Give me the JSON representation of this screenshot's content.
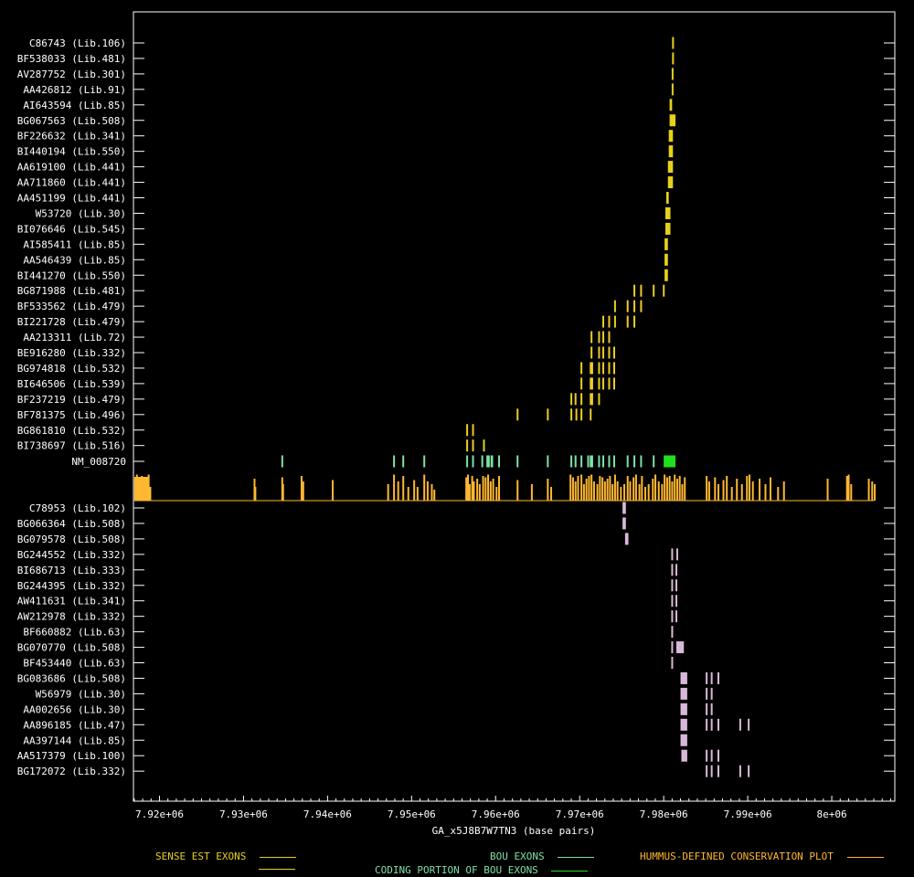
{
  "chart_data": {
    "type": "gene-track",
    "xlabel": "GA_x5J8B7W7TN3 (base pairs)",
    "x_ticks": [
      "7.92e+06",
      "7.93e+06",
      "7.94e+06",
      "7.95e+06",
      "7.96e+06",
      "7.97e+06",
      "7.98e+06",
      "7.99e+06",
      "8e+06"
    ],
    "x_tick_values": [
      7920000,
      7930000,
      7940000,
      7950000,
      7960000,
      7970000,
      7980000,
      7990000,
      8000000
    ],
    "xlim": [
      7916900,
      8007500
    ],
    "colors": {
      "sense": "#e6d01e",
      "sense_light": "#f0c830",
      "bou": "#7fe0a8",
      "bou_coding": "#20e020",
      "conservation": "#ffb830",
      "antisense": "#d8b8d8",
      "axis": "#ffffff"
    },
    "sense_ests": [
      {
        "label": "C86743 (Lib.106)",
        "exons": [
          [
            7981000,
            7981200
          ]
        ]
      },
      {
        "label": "BF538033 (Lib.481)",
        "exons": [
          [
            7981000,
            7981200
          ]
        ]
      },
      {
        "label": "AV287752 (Lib.301)",
        "exons": [
          [
            7980950,
            7981150
          ]
        ]
      },
      {
        "label": "AA426812 (Lib.91)",
        "exons": [
          [
            7980950,
            7981150
          ]
        ]
      },
      {
        "label": "AI643594 (Lib.85)",
        "exons": [
          [
            7980700,
            7981000
          ]
        ]
      },
      {
        "label": "BG067563 (Lib.508)",
        "exons": [
          [
            7980700,
            7981400
          ]
        ]
      },
      {
        "label": "BF226632 (Lib.341)",
        "exons": [
          [
            7980600,
            7981100
          ]
        ]
      },
      {
        "label": "BI440194 (Lib.550)",
        "exons": [
          [
            7980600,
            7981100
          ]
        ]
      },
      {
        "label": "AA619100 (Lib.441)",
        "exons": [
          [
            7980500,
            7981100
          ]
        ]
      },
      {
        "label": "AA711860 (Lib.441)",
        "exons": [
          [
            7980500,
            7981100
          ]
        ]
      },
      {
        "label": "AA451199 (Lib.441)",
        "exons": [
          [
            7980300,
            7980600
          ]
        ]
      },
      {
        "label": "W53720 (Lib.30)",
        "exons": [
          [
            7980200,
            7980800
          ]
        ]
      },
      {
        "label": "BI076646 (Lib.545)",
        "exons": [
          [
            7980200,
            7980800
          ]
        ]
      },
      {
        "label": "AI585411 (Lib.85)",
        "exons": [
          [
            7980100,
            7980500
          ]
        ]
      },
      {
        "label": "AA546439 (Lib.85)",
        "exons": [
          [
            7980100,
            7980500
          ]
        ]
      },
      {
        "label": "BI441270 (Lib.550)",
        "exons": [
          [
            7980100,
            7980500
          ]
        ]
      },
      {
        "label": "BG871988 (Lib.481)",
        "exons": [
          [
            7976400,
            7976600
          ],
          [
            7977200,
            7977400
          ],
          [
            7978700,
            7978900
          ],
          [
            7979900,
            7980100
          ]
        ]
      },
      {
        "label": "BF533562 (Lib.479)",
        "exons": [
          [
            7974100,
            7974300
          ],
          [
            7975600,
            7975800
          ],
          [
            7976400,
            7976600
          ],
          [
            7977200,
            7977400
          ]
        ]
      },
      {
        "label": "BI221728 (Lib.479)",
        "exons": [
          [
            7972700,
            7972900
          ],
          [
            7973400,
            7973600
          ],
          [
            7974100,
            7974300
          ],
          [
            7975600,
            7975800
          ],
          [
            7976400,
            7976600
          ]
        ]
      },
      {
        "label": "AA213311 (Lib.72)",
        "exons": [
          [
            7971300,
            7971500
          ],
          [
            7972200,
            7972400
          ],
          [
            7972700,
            7972900
          ],
          [
            7973400,
            7973600
          ]
        ]
      },
      {
        "label": "BE916280 (Lib.332)",
        "exons": [
          [
            7971300,
            7971500
          ],
          [
            7972200,
            7972400
          ],
          [
            7972700,
            7972900
          ],
          [
            7973400,
            7973600
          ],
          [
            7974000,
            7974200
          ]
        ]
      },
      {
        "label": "BG974818 (Lib.532)",
        "exons": [
          [
            7970100,
            7970300
          ],
          [
            7971200,
            7971600
          ],
          [
            7972200,
            7972400
          ],
          [
            7972700,
            7972900
          ],
          [
            7973400,
            7973600
          ],
          [
            7974000,
            7974200
          ]
        ]
      },
      {
        "label": "BI646506 (Lib.539)",
        "exons": [
          [
            7970100,
            7970300
          ],
          [
            7971200,
            7971600
          ],
          [
            7972200,
            7972400
          ],
          [
            7972700,
            7972900
          ],
          [
            7973400,
            7973600
          ],
          [
            7974000,
            7974200
          ]
        ]
      },
      {
        "label": "BF237219 (Lib.479)",
        "exons": [
          [
            7968900,
            7969100
          ],
          [
            7969400,
            7969600
          ],
          [
            7970100,
            7970300
          ],
          [
            7971200,
            7971600
          ],
          [
            7972200,
            7972400
          ]
        ]
      },
      {
        "label": "BF781375 (Lib.496)",
        "exons": [
          [
            7962500,
            7962700
          ],
          [
            7966100,
            7966300
          ],
          [
            7968900,
            7969100
          ],
          [
            7969500,
            7969700
          ],
          [
            7970100,
            7970300
          ],
          [
            7971200,
            7971400
          ]
        ]
      },
      {
        "label": "BG861810 (Lib.532)",
        "exons": [
          [
            7956500,
            7956700
          ],
          [
            7957200,
            7957400
          ]
        ]
      },
      {
        "label": "BI738697 (Lib.516)",
        "exons": [
          [
            7956500,
            7956700
          ],
          [
            7957200,
            7957400
          ],
          [
            7958500,
            7958600
          ]
        ]
      }
    ],
    "bou": {
      "label": "NM_008720",
      "exons": [
        [
          7934500,
          7934700
        ],
        [
          7947800,
          7948000
        ],
        [
          7948900,
          7949100
        ],
        [
          7951400,
          7951600
        ],
        [
          7956500,
          7956700
        ],
        [
          7957200,
          7957400
        ],
        [
          7958300,
          7958500
        ],
        [
          7958900,
          7959300
        ],
        [
          7959400,
          7959700
        ],
        [
          7960300,
          7960500
        ],
        [
          7962500,
          7962700
        ],
        [
          7966100,
          7966300
        ],
        [
          7968900,
          7969100
        ],
        [
          7969400,
          7969600
        ],
        [
          7970100,
          7970300
        ],
        [
          7970900,
          7971100
        ],
        [
          7971200,
          7971600
        ],
        [
          7972200,
          7972400
        ],
        [
          7972700,
          7972900
        ],
        [
          7973400,
          7973600
        ],
        [
          7974000,
          7974200
        ],
        [
          7975600,
          7975800
        ],
        [
          7976400,
          7976600
        ],
        [
          7977200,
          7977400
        ],
        [
          7978700,
          7978900
        ],
        [
          7980000,
          7981400
        ]
      ]
    },
    "conservation": [
      [
        7917000,
        0.8
      ],
      [
        7917200,
        0.95
      ],
      [
        7917400,
        0.7
      ],
      [
        7917600,
        0.85
      ],
      [
        7917800,
        0.9
      ],
      [
        7918000,
        0.75
      ],
      [
        7918200,
        0.8
      ],
      [
        7918400,
        0.6
      ],
      [
        7918600,
        0.95
      ],
      [
        7918800,
        0.5
      ],
      [
        7931200,
        0.8
      ],
      [
        7931300,
        0.5
      ],
      [
        7934500,
        0.85
      ],
      [
        7934600,
        0.6
      ],
      [
        7936800,
        0.9
      ],
      [
        7937000,
        0.7
      ],
      [
        7940500,
        0.75
      ],
      [
        7947100,
        0.6
      ],
      [
        7947800,
        0.95
      ],
      [
        7948300,
        0.7
      ],
      [
        7948900,
        0.9
      ],
      [
        7949500,
        0.5
      ],
      [
        7950200,
        0.75
      ],
      [
        7950600,
        0.5
      ],
      [
        7951400,
        0.95
      ],
      [
        7951800,
        0.7
      ],
      [
        7952300,
        0.6
      ],
      [
        7952600,
        0.4
      ],
      [
        7956400,
        0.85
      ],
      [
        7956600,
        0.95
      ],
      [
        7956800,
        0.6
      ],
      [
        7957100,
        0.9
      ],
      [
        7957300,
        0.7
      ],
      [
        7957700,
        0.8
      ],
      [
        7958000,
        0.6
      ],
      [
        7958400,
        0.9
      ],
      [
        7958700,
        0.85
      ],
      [
        7959000,
        0.95
      ],
      [
        7959300,
        0.7
      ],
      [
        7959600,
        0.8
      ],
      [
        7960000,
        0.5
      ],
      [
        7960300,
        0.9
      ],
      [
        7962500,
        0.75
      ],
      [
        7964200,
        0.6
      ],
      [
        7966100,
        0.8
      ],
      [
        7966500,
        0.5
      ],
      [
        7968800,
        0.95
      ],
      [
        7969100,
        0.85
      ],
      [
        7969400,
        0.7
      ],
      [
        7969700,
        0.9
      ],
      [
        7970100,
        0.95
      ],
      [
        7970400,
        0.6
      ],
      [
        7970700,
        0.8
      ],
      [
        7971000,
        0.9
      ],
      [
        7971300,
        0.95
      ],
      [
        7971600,
        0.7
      ],
      [
        7972000,
        0.6
      ],
      [
        7972300,
        0.9
      ],
      [
        7972600,
        0.85
      ],
      [
        7972900,
        0.7
      ],
      [
        7973200,
        0.8
      ],
      [
        7973500,
        0.9
      ],
      [
        7973800,
        0.6
      ],
      [
        7974100,
        0.95
      ],
      [
        7974400,
        0.7
      ],
      [
        7974800,
        0.5
      ],
      [
        7975200,
        0.6
      ],
      [
        7975600,
        0.9
      ],
      [
        7975900,
        0.7
      ],
      [
        7976300,
        0.85
      ],
      [
        7976600,
        0.95
      ],
      [
        7977000,
        0.6
      ],
      [
        7977300,
        0.9
      ],
      [
        7977700,
        0.5
      ],
      [
        7978100,
        0.6
      ],
      [
        7978600,
        0.8
      ],
      [
        7978900,
        0.95
      ],
      [
        7979300,
        0.7
      ],
      [
        7979700,
        0.6
      ],
      [
        7980000,
        0.95
      ],
      [
        7980300,
        0.85
      ],
      [
        7980600,
        0.9
      ],
      [
        7980900,
        0.7
      ],
      [
        7981200,
        0.95
      ],
      [
        7981500,
        0.8
      ],
      [
        7981800,
        0.9
      ],
      [
        7982100,
        0.6
      ],
      [
        7982400,
        0.85
      ],
      [
        7985000,
        0.9
      ],
      [
        7985300,
        0.7
      ],
      [
        7986000,
        0.85
      ],
      [
        7986400,
        0.6
      ],
      [
        7987000,
        0.75
      ],
      [
        7987400,
        0.9
      ],
      [
        7988000,
        0.5
      ],
      [
        7988600,
        0.8
      ],
      [
        7989200,
        0.6
      ],
      [
        7989800,
        0.9
      ],
      [
        7990100,
        0.95
      ],
      [
        7990500,
        0.7
      ],
      [
        7991300,
        0.8
      ],
      [
        7992000,
        0.6
      ],
      [
        7992600,
        0.85
      ],
      [
        7993500,
        0.5
      ],
      [
        7994200,
        0.7
      ],
      [
        7999400,
        0.8
      ],
      [
        8001700,
        0.9
      ],
      [
        8001900,
        0.95
      ],
      [
        8002200,
        0.6
      ],
      [
        8004300,
        0.8
      ],
      [
        8004700,
        0.7
      ],
      [
        8005000,
        0.6
      ]
    ],
    "antisense_ests": [
      {
        "label": "C78953 (Lib.102)",
        "exons": [
          [
            7975100,
            7975500
          ]
        ]
      },
      {
        "label": "BG066364 (Lib.508)",
        "exons": [
          [
            7975100,
            7975500
          ]
        ]
      },
      {
        "label": "BG079578 (Lib.508)",
        "exons": [
          [
            7975400,
            7975800
          ]
        ]
      },
      {
        "label": "BG244552 (Lib.332)",
        "exons": [
          [
            7980900,
            7981100
          ],
          [
            7981500,
            7981700
          ]
        ]
      },
      {
        "label": "BI686713 (Lib.333)",
        "exons": [
          [
            7980900,
            7981100
          ],
          [
            7981400,
            7981600
          ]
        ]
      },
      {
        "label": "BG244395 (Lib.332)",
        "exons": [
          [
            7980900,
            7981100
          ],
          [
            7981400,
            7981600
          ]
        ]
      },
      {
        "label": "AW411631 (Lib.341)",
        "exons": [
          [
            7980900,
            7981100
          ],
          [
            7981400,
            7981600
          ]
        ]
      },
      {
        "label": "AW212978 (Lib.332)",
        "exons": [
          [
            7980900,
            7981100
          ],
          [
            7981400,
            7981600
          ]
        ]
      },
      {
        "label": "BF660882 (Lib.63)",
        "exons": [
          [
            7980900,
            7981100
          ]
        ]
      },
      {
        "label": "BG070770 (Lib.508)",
        "exons": [
          [
            7980900,
            7981100
          ],
          [
            7981500,
            7982400
          ]
        ]
      },
      {
        "label": "BF453440 (Lib.63)",
        "exons": [
          [
            7980900,
            7981100
          ]
        ]
      },
      {
        "label": "BG083686 (Lib.508)",
        "exons": [
          [
            7982000,
            7982800
          ],
          [
            7985000,
            7985200
          ],
          [
            7985600,
            7985800
          ],
          [
            7986400,
            7986600
          ]
        ]
      },
      {
        "label": "W56979 (Lib.30)",
        "exons": [
          [
            7982000,
            7982800
          ],
          [
            7985000,
            7985200
          ],
          [
            7985600,
            7985800
          ]
        ]
      },
      {
        "label": "AA002656 (Lib.30)",
        "exons": [
          [
            7982000,
            7982800
          ],
          [
            7985000,
            7985200
          ],
          [
            7985600,
            7985800
          ]
        ]
      },
      {
        "label": "AA896185 (Lib.47)",
        "exons": [
          [
            7982000,
            7982800
          ],
          [
            7985000,
            7985200
          ],
          [
            7985600,
            7985800
          ],
          [
            7986400,
            7986600
          ],
          [
            7989000,
            7989200
          ],
          [
            7990000,
            7990200
          ]
        ]
      },
      {
        "label": "AA397144 (Lib.85)",
        "exons": [
          [
            7982000,
            7982800
          ]
        ]
      },
      {
        "label": "AA517379 (Lib.100)",
        "exons": [
          [
            7982100,
            7982800
          ],
          [
            7985000,
            7985200
          ],
          [
            7985600,
            7985800
          ],
          [
            7986400,
            7986600
          ]
        ]
      },
      {
        "label": "BG172072 (Lib.332)",
        "exons": [
          [
            7985000,
            7985200
          ],
          [
            7985600,
            7985800
          ],
          [
            7986400,
            7986600
          ],
          [
            7989000,
            7989200
          ],
          [
            7990000,
            7990200
          ]
        ]
      }
    ]
  },
  "legend": {
    "sense": "SENSE EST EXONS",
    "bou": "BOU EXONS",
    "coding": "CODING PORTION OF BOU EXONS",
    "conservation": "HUMMUS-DEFINED CONSERVATION PLOT"
  }
}
